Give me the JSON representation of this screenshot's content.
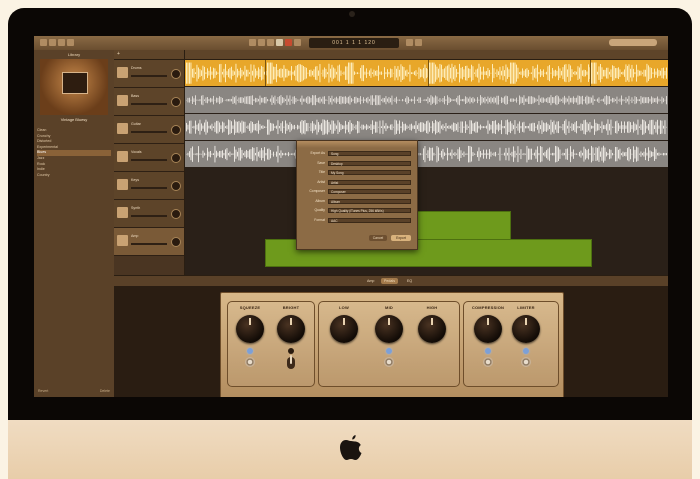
{
  "app": {
    "window_title": "GarageBand"
  },
  "toolbar": {
    "lcd_text": "001  1  1  1  120"
  },
  "library": {
    "title": "Library",
    "selected_patch": "Vintage Bluesy",
    "items": [
      "Clean",
      "Crunchy",
      "Distorted",
      "Experimental",
      "Blues",
      "Jazz",
      "Rock",
      "Indie",
      "Country",
      "Pop",
      "Hip Hop",
      "Experimental"
    ],
    "selected_index": 4,
    "footer_revert": "Revert",
    "footer_delete": "Delete"
  },
  "tracks": [
    {
      "name": "Drums",
      "icon": "drum-icon"
    },
    {
      "name": "Bass",
      "icon": "bass-icon"
    },
    {
      "name": "Guitar",
      "icon": "guitar-icon"
    },
    {
      "name": "Vocals",
      "icon": "mic-icon"
    },
    {
      "name": "Keys",
      "icon": "keyboard-icon"
    },
    {
      "name": "Synth",
      "icon": "synth-icon"
    },
    {
      "name": "Amp",
      "icon": "amp-icon"
    }
  ],
  "dialog": {
    "rows": [
      {
        "label": "Export As",
        "value": "Song"
      },
      {
        "label": "Save",
        "value": "Desktop"
      },
      {
        "label": "Title",
        "value": "My Song"
      },
      {
        "label": "Artist",
        "value": "Artist"
      },
      {
        "label": "Composer",
        "value": "Composer"
      },
      {
        "label": "Album",
        "value": "Album"
      },
      {
        "label": "Quality",
        "value": "High Quality (iTunes Plus, 256 kBit/s)"
      },
      {
        "label": "Format",
        "value": "AAC"
      }
    ],
    "cancel_label": "Cancel",
    "export_label": "Export"
  },
  "smart_controls": {
    "tabs": [
      "Amp",
      "Pedals",
      "EQ"
    ],
    "active_tab": 1,
    "knobs": [
      {
        "label": "SQUEEZE"
      },
      {
        "label": "BRIGHT"
      },
      {
        "label": "LOW"
      },
      {
        "label": "MID"
      },
      {
        "label": "HIGH"
      },
      {
        "label": "COMPRESSION"
      },
      {
        "label": "LIMITER"
      }
    ]
  },
  "colors": {
    "drums_region": "#e8a72a",
    "audio_region": "#8a8682",
    "midi_region": "#6e9a1c",
    "status_jewel": "#7da0d6"
  }
}
